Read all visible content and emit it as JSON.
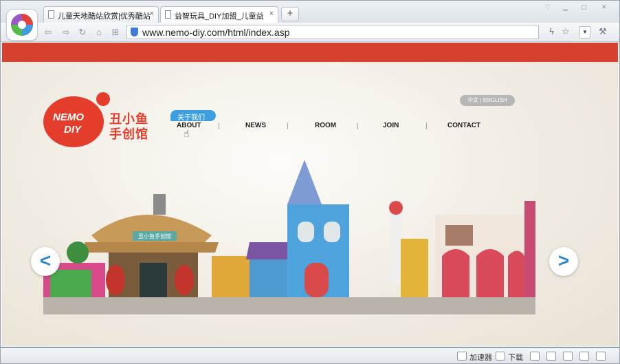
{
  "tabs": [
    {
      "label": "儿童天地酷站欣赏|优秀酷站",
      "close": "×"
    },
    {
      "label": "益智玩具_DIY加盟_儿童益",
      "close": "×"
    }
  ],
  "newtab": "+",
  "address": {
    "url": "www.nemo-diy.com/html/index.asp"
  },
  "site": {
    "logo_l1": "NEMO",
    "logo_l2": "DIY",
    "logo_cn": "丑小鱼 手创馆",
    "tooltip": "关于我们",
    "lang": "中文 | ENGLISH",
    "nav": [
      "ABOUT",
      "NEWS",
      "ROOM",
      "JOIN",
      "CONTACT"
    ],
    "sep": "|",
    "banner_sign": "丑小鱼手创馆",
    "prev": "<",
    "next": ">"
  },
  "status": {
    "accelerator": "加速器",
    "download": "下载"
  },
  "colors": {
    "brand": "#e53d2c",
    "accent": "#3d9fe0",
    "band": "#d7412f"
  }
}
